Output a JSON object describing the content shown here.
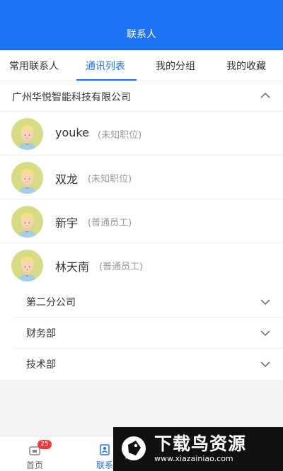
{
  "header": {
    "title": "联系人"
  },
  "tabs": [
    {
      "label": "常用联系人"
    },
    {
      "label": "通讯列表"
    },
    {
      "label": "我的分组"
    },
    {
      "label": "我的收藏"
    }
  ],
  "active_tab": "通讯列表",
  "company": {
    "name": "广州华悦智能科技有限公司"
  },
  "contacts": [
    {
      "name": "youke",
      "role": "(未知职位)"
    },
    {
      "name": "双龙",
      "role": "(未知职位)"
    },
    {
      "name": "新宇",
      "role": "(普通员工)"
    },
    {
      "name": "林天南",
      "role": "(普通员工)"
    }
  ],
  "departments": [
    {
      "name": "第二分公司"
    },
    {
      "name": "财务部"
    },
    {
      "name": "技术部"
    }
  ],
  "bottom_nav": [
    {
      "label": "首页",
      "badge": "25",
      "icon": "home-icon"
    },
    {
      "label": "联系",
      "icon": "contacts-icon"
    }
  ],
  "watermark": {
    "text": "下载鸟资源",
    "url": "www.xiazainiao.com"
  },
  "colors": {
    "accent": "#1d72f5",
    "badge": "#f03a3a",
    "avatar_bg": "#d6dc86"
  }
}
